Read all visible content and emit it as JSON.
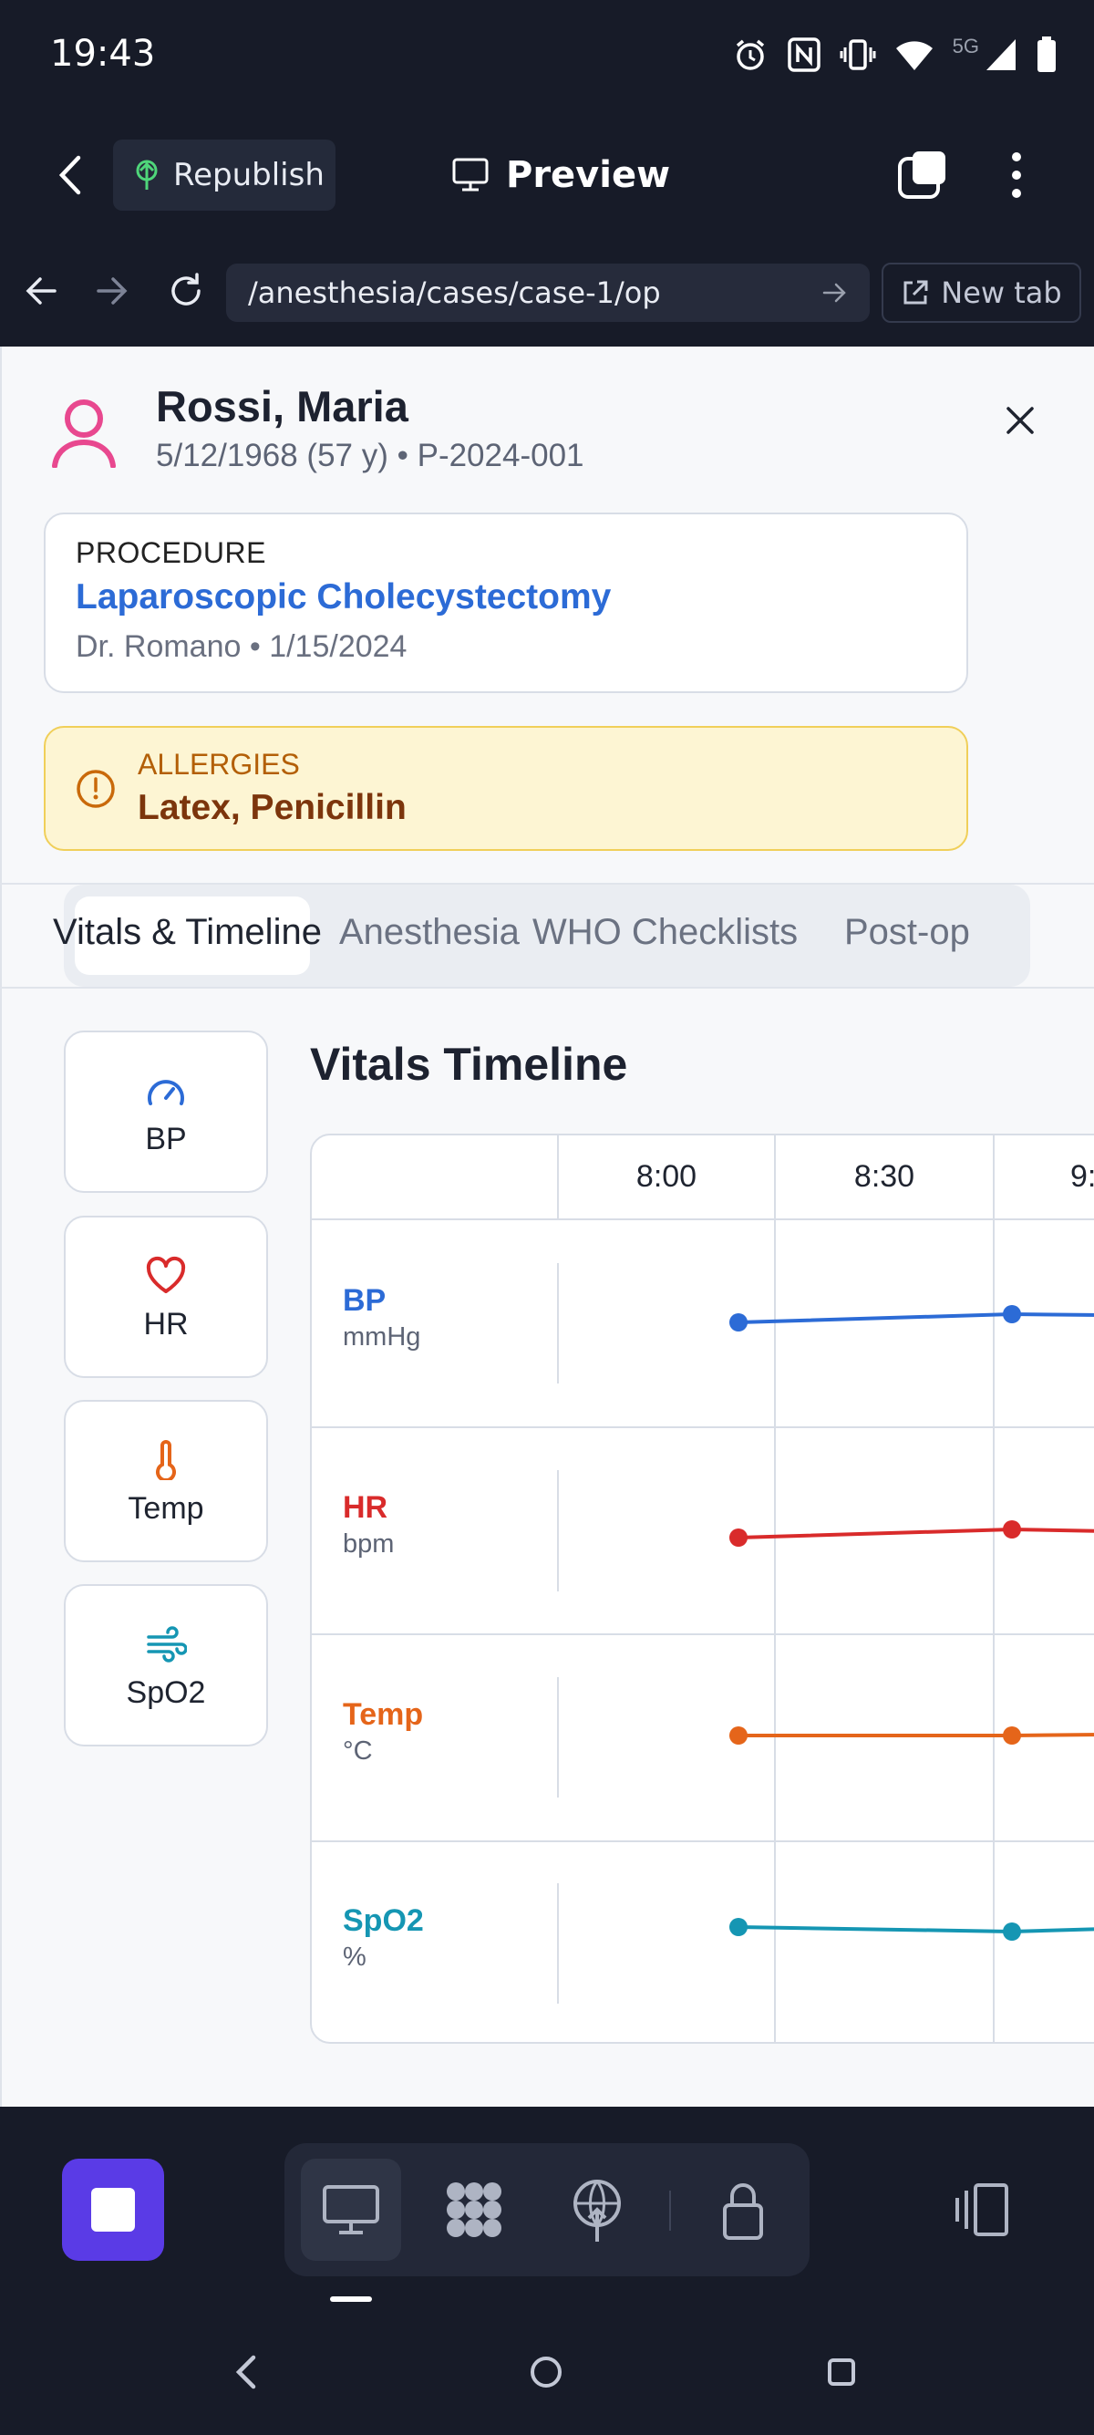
{
  "status_bar": {
    "time": "19:43",
    "network": "5G"
  },
  "toolbar": {
    "republish_label": "Republish",
    "preview_label": "Preview"
  },
  "browser": {
    "url": "/anesthesia/cases/case-1/op",
    "new_tab_label": "New tab"
  },
  "patient": {
    "name": "Rossi, Maria",
    "meta": "5/12/1968 (57 y) • P-2024-001"
  },
  "procedure": {
    "label": "PROCEDURE",
    "name": "Laparoscopic Cholecystectomy",
    "meta": "Dr. Romano • 1/15/2024"
  },
  "allergies": {
    "label": "ALLERGIES",
    "value": "Latex, Penicillin"
  },
  "tabs": [
    {
      "label": "Vitals & Timeline",
      "active": true
    },
    {
      "label": "Anesthesia",
      "active": false
    },
    {
      "label": "WHO Checklists",
      "active": false
    },
    {
      "label": "Post-op",
      "active": false
    }
  ],
  "vital_buttons": [
    {
      "label": "BP",
      "icon": "gauge-icon",
      "color": "#2c6bd6"
    },
    {
      "label": "HR",
      "icon": "heart-icon",
      "color": "#d92b2b"
    },
    {
      "label": "Temp",
      "icon": "thermometer-icon",
      "color": "#e5651a"
    },
    {
      "label": "SpO2",
      "icon": "wind-icon",
      "color": "#1596b3"
    }
  ],
  "timeline": {
    "title": "Vitals Timeline",
    "time_headers": [
      "8:00",
      "8:30",
      "9:"
    ],
    "rows": [
      {
        "name": "BP",
        "unit": "mmHg",
        "color": "#2c6bd6"
      },
      {
        "name": "HR",
        "unit": "bpm",
        "color": "#d92b2b"
      },
      {
        "name": "Temp",
        "unit": "°C",
        "color": "#e5651a"
      },
      {
        "name": "SpO2",
        "unit": "%",
        "color": "#1596b3"
      }
    ]
  }
}
